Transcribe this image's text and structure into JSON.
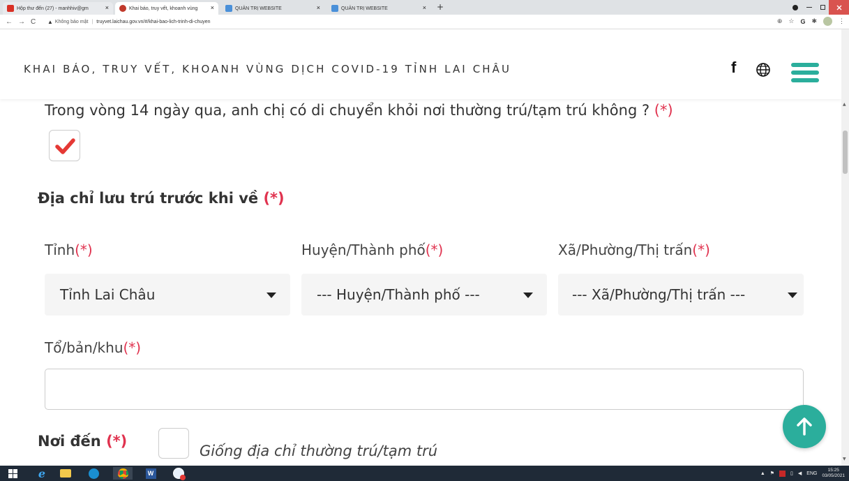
{
  "browser": {
    "tabs": [
      {
        "title": "Hộp thư đến (27) - manhhiv@gm",
        "close": "×"
      },
      {
        "title": "Khai báo, truy vết, khoanh vùng",
        "close": "×"
      },
      {
        "title": "QUẢN TRỊ WEBSITE",
        "close": "×"
      },
      {
        "title": "QUẢN TRỊ WEBSITE",
        "close": "×"
      }
    ],
    "new_tab": "+",
    "security_label": "Không bảo mật",
    "url": "truyvet.laichau.gov.vn/#/khai-bao-lich-trinh-di-chuyen"
  },
  "header": {
    "title": "KHAI BÁO, TRUY VẾT, KHOANH VÙNG DỊCH COVID-19 TỈNH LAI CHÂU",
    "facebook": "f"
  },
  "form": {
    "question": "Trong vòng 14 ngày qua, anh chị có di chuyển khỏi nơi thường trú/tạm trú không ?",
    "required_mark": "(*)",
    "moved_checked": true,
    "section_title": "Địa chỉ lưu trú trước khi về",
    "province_label": "Tỉnh",
    "district_label": "Huyện/Thành phố",
    "ward_label": "Xã/Phường/Thị trấn",
    "province_value": "Tỉnh Lai Châu",
    "district_value": "--- Huyện/Thành phố ---",
    "ward_value": "--- Xã/Phường/Thị trấn ---",
    "hamlet_label": "Tổ/bản/khu",
    "hamlet_value": "",
    "destination_label": "Nơi đến",
    "same_address_label": "Giống địa chỉ thường trú/tạm trú",
    "same_address_checked": false
  },
  "taskbar": {
    "language": "ENG",
    "time": "15:25",
    "date": "03/05/2021"
  },
  "colors": {
    "accent": "#2bae9c",
    "required": "#e0334f",
    "check": "#e53935"
  }
}
